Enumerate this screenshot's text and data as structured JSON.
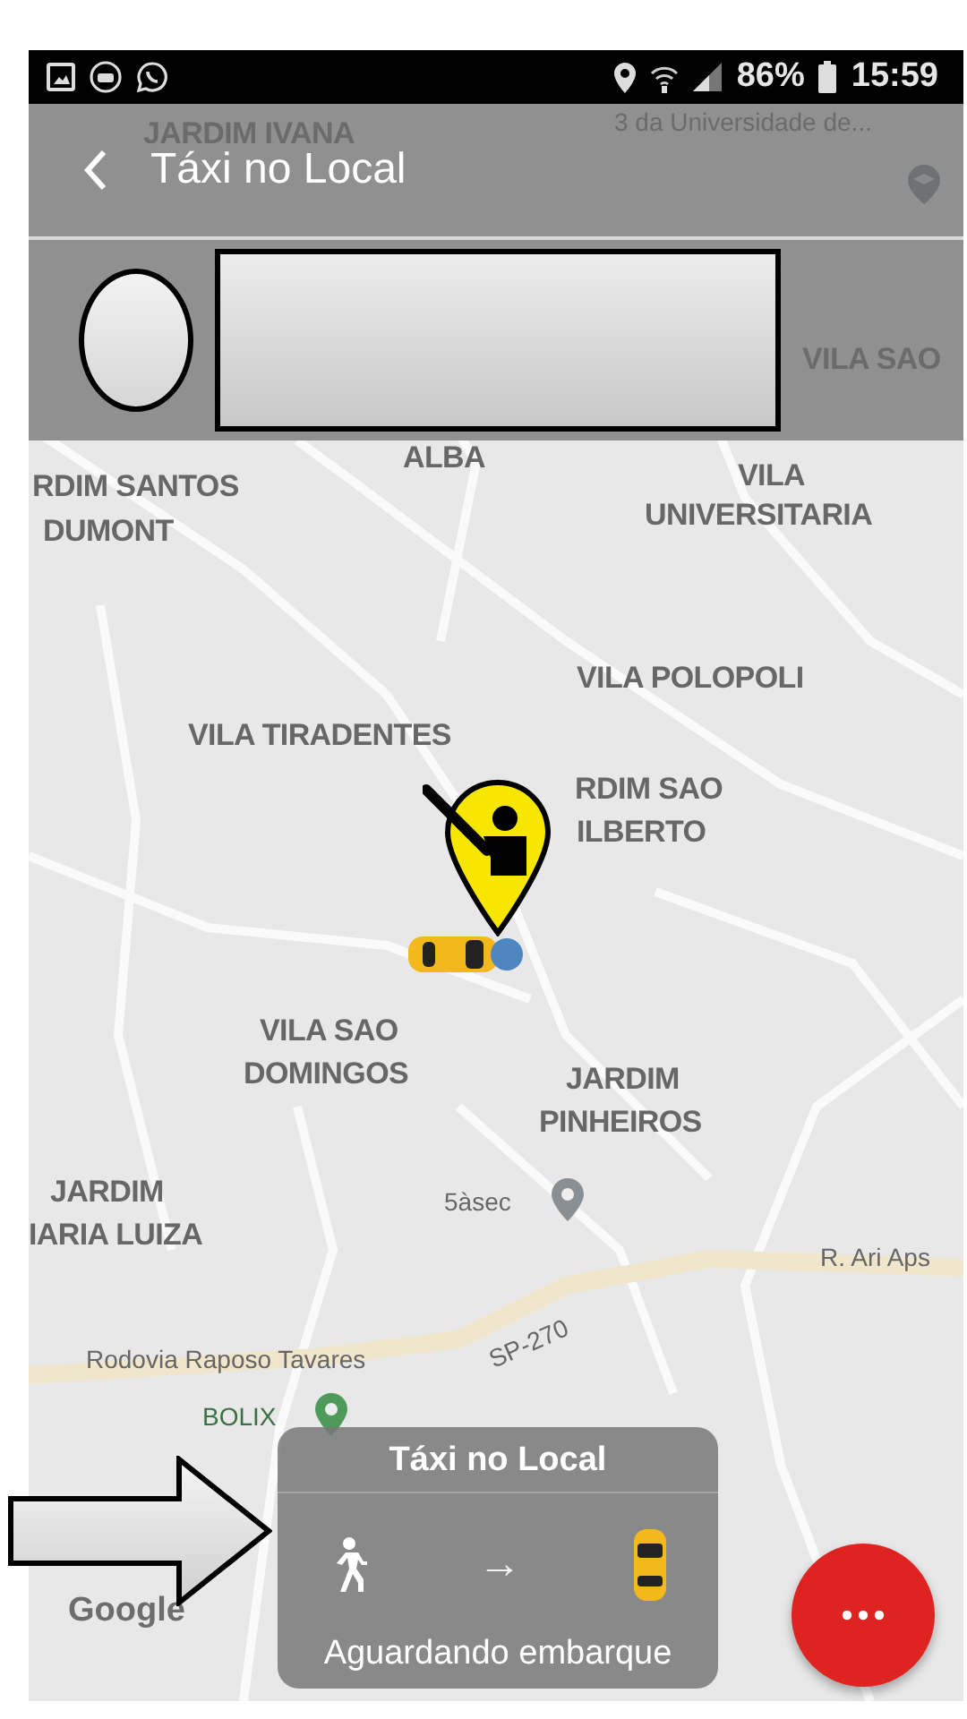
{
  "status_bar": {
    "battery": "86%",
    "time": "15:59"
  },
  "header": {
    "title": "Táxi no Local"
  },
  "map": {
    "labels": [
      {
        "text": "JARDIM IVANA",
        "kind": "area"
      },
      {
        "text": "3 da Universidade de...",
        "kind": "poi"
      },
      {
        "text": "VILA SAO",
        "kind": "area"
      },
      {
        "text": "ALBA",
        "kind": "area"
      },
      {
        "text": "RDIM SANTOS",
        "kind": "area"
      },
      {
        "text": "DUMONT",
        "kind": "area"
      },
      {
        "text": "VILA",
        "kind": "area"
      },
      {
        "text": "UNIVERSITARIA",
        "kind": "area"
      },
      {
        "text": "VILA POLOPOLI",
        "kind": "area"
      },
      {
        "text": "VILA TIRADENTES",
        "kind": "area"
      },
      {
        "text": "RDIM SAO",
        "kind": "area"
      },
      {
        "text": "ILBERTO",
        "kind": "area"
      },
      {
        "text": "VILA SAO",
        "kind": "area"
      },
      {
        "text": "DOMINGOS",
        "kind": "area"
      },
      {
        "text": "JARDIM",
        "kind": "area"
      },
      {
        "text": "PINHEIROS",
        "kind": "area"
      },
      {
        "text": "5àsec",
        "kind": "poi"
      },
      {
        "text": "JARDIM",
        "kind": "area"
      },
      {
        "text": "IARIA LUIZA",
        "kind": "area"
      },
      {
        "text": "R. Ari Aps",
        "kind": "street"
      },
      {
        "text": "SP-270",
        "kind": "street"
      },
      {
        "text": "Rodovia Raposo Tavares",
        "kind": "street"
      },
      {
        "text": "BOLIX",
        "kind": "place"
      },
      {
        "text": "Google",
        "kind": "logo"
      }
    ]
  },
  "ride_card": {
    "title": "Táxi no Local",
    "arrow": "→",
    "status": "Aguardando embarque"
  }
}
